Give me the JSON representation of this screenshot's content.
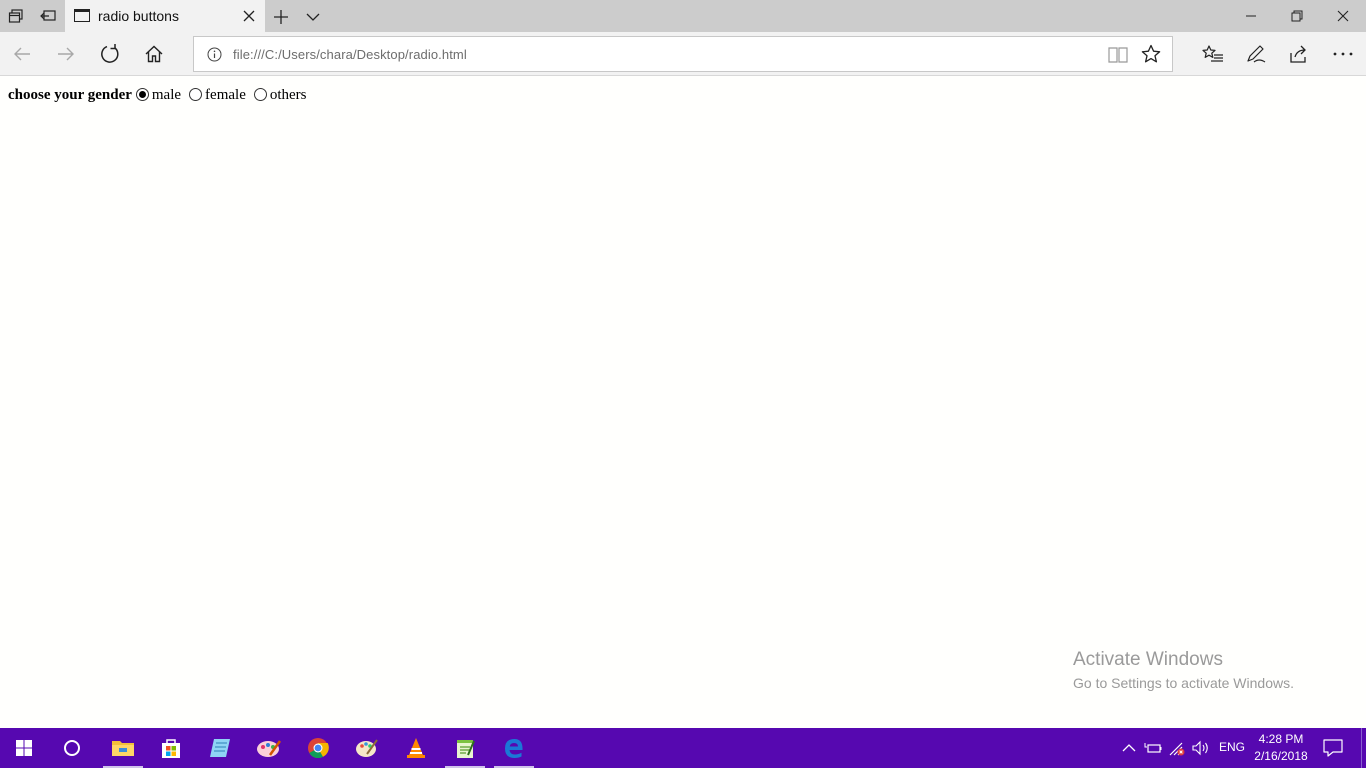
{
  "browser": {
    "tab": {
      "title": "radio buttons"
    },
    "address": {
      "url": "file:///C:/Users/chara/Desktop/radio.html"
    }
  },
  "page": {
    "label": "choose your gender",
    "options": [
      {
        "label": "male",
        "checked": true
      },
      {
        "label": "female",
        "checked": false
      },
      {
        "label": "others",
        "checked": false
      }
    ]
  },
  "watermark": {
    "title": "Activate Windows",
    "subtitle": "Go to Settings to activate Windows."
  },
  "taskbar": {
    "pinned": [
      "start-icon",
      "cortana-icon",
      "file-explorer-icon",
      "store-icon",
      "notepad-icon",
      "paint3d-icon",
      "chrome-icon",
      "paint-icon",
      "vlc-icon",
      "notepadpp-icon",
      "edge-icon"
    ],
    "language": "ENG",
    "time": "4:28 PM",
    "date": "2/16/2018"
  },
  "colors": {
    "taskbar": "#5608b0",
    "tab_strip": "#cccccc",
    "chrome": "#f2f2f2",
    "edge_blue": "#1b78d6"
  }
}
